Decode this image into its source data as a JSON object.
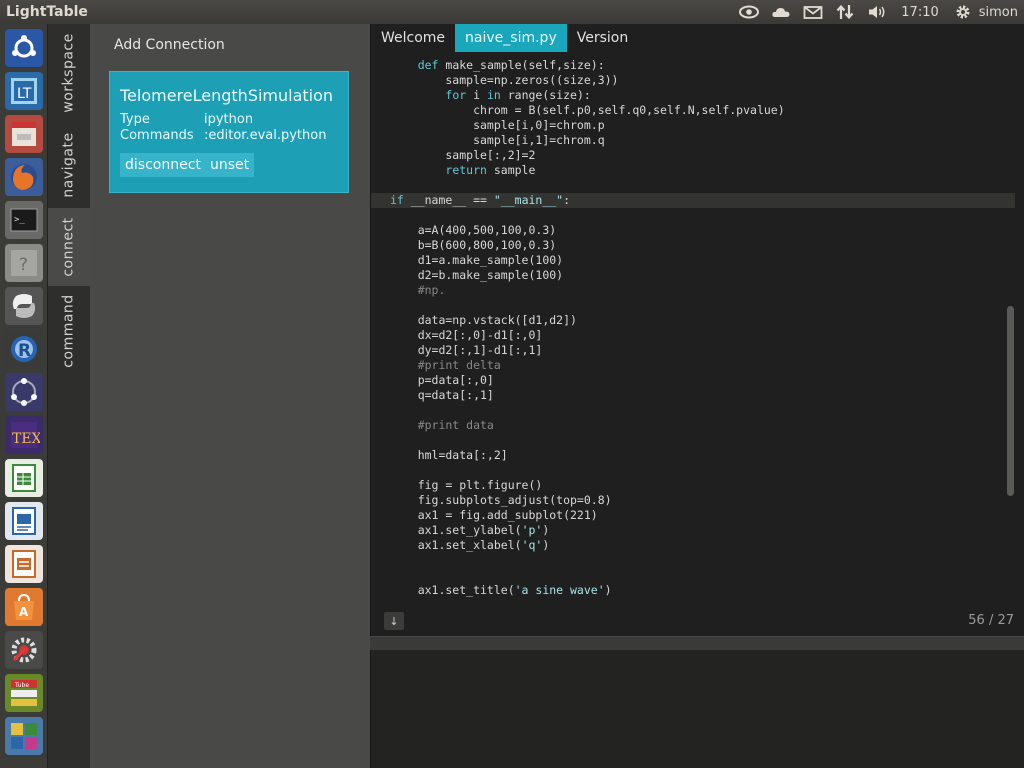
{
  "topbar": {
    "app_title": "LightTable",
    "clock": "17:10",
    "user": "simon",
    "indicators": [
      "eye-icon",
      "cloud-icon",
      "mail-icon",
      "network-icon",
      "volume-icon"
    ]
  },
  "launcher": {
    "items": [
      {
        "name": "ubuntu-home-icon",
        "color": "#2a58a6"
      },
      {
        "name": "lighttable-icon",
        "color": "#2b6aa8"
      },
      {
        "name": "file-cabinet-icon",
        "color": "#b54a40"
      },
      {
        "name": "firefox-icon",
        "color": "#e0682a"
      },
      {
        "name": "terminal-icon",
        "color": "#2a2a2a"
      },
      {
        "name": "help-icon",
        "color": "#8b8b88"
      },
      {
        "name": "python-icon",
        "color": "#555"
      },
      {
        "name": "r-icon",
        "color": "#2663b0"
      },
      {
        "name": "network-graph-icon",
        "color": "#3a3a6a"
      },
      {
        "name": "tex-icon",
        "color": "#3b2b6a"
      },
      {
        "name": "calc-icon",
        "color": "#3a8c3a"
      },
      {
        "name": "writer-icon",
        "color": "#2b66a8"
      },
      {
        "name": "impress-icon",
        "color": "#c46a2a"
      },
      {
        "name": "software-center-icon",
        "color": "#e07a30"
      },
      {
        "name": "settings-icon",
        "color": "#c43a3a"
      },
      {
        "name": "stacked-apps-icon",
        "color": "#6a8a2a"
      },
      {
        "name": "workspace-switcher-icon",
        "color": "#4a7aaa"
      }
    ]
  },
  "sidebar": {
    "tabs": [
      "workspace",
      "navigate",
      "connect",
      "command"
    ]
  },
  "connect_panel": {
    "title": "Add Connection",
    "connection": {
      "name": "TelomereLengthSimulation",
      "type_label": "Type",
      "type_value": "ipython",
      "commands_label": "Commands",
      "commands_value": ":editor.eval.python",
      "disconnect_label": "disconnect",
      "unset_label": "unset"
    }
  },
  "editor": {
    "tabs": [
      {
        "label": "Welcome",
        "active": false
      },
      {
        "label": "naive_sim.py",
        "active": true
      },
      {
        "label": "Version",
        "active": false
      }
    ],
    "lines": [
      "    def make_sample(self,size):",
      "        sample=np.zeros((size,3))",
      "        for i in range(size):",
      "            chrom = B(self.p0,self.q0,self.N,self.pvalue)",
      "            sample[i,0]=chrom.p",
      "            sample[i,1]=chrom.q",
      "        sample[:,2]=2",
      "        return sample",
      "",
      "if __name__ == \"__main__\":",
      "",
      "    a=A(400,500,100,0.3)",
      "    b=B(600,800,100,0.3)",
      "    d1=a.make_sample(100)",
      "    d2=b.make_sample(100)",
      "    #np.",
      "",
      "    data=np.vstack([d1,d2])",
      "    dx=d2[:,0]-d1[:,0]",
      "    dy=d2[:,1]-d1[:,1]",
      "    #print delta",
      "    p=data[:,0]",
      "    q=data[:,1]",
      "",
      "    #print data",
      "",
      "    hml=data[:,2]",
      "",
      "    fig = plt.figure()",
      "    fig.subplots_adjust(top=0.8)",
      "    ax1 = fig.add_subplot(221)",
      "    ax1.set_ylabel('p')",
      "    ax1.set_xlabel('q')",
      "",
      "",
      "    ax1.set_title('a sine wave')"
    ],
    "active_line": 9,
    "scroll_down_label": "↓",
    "position": "56 / 27"
  }
}
